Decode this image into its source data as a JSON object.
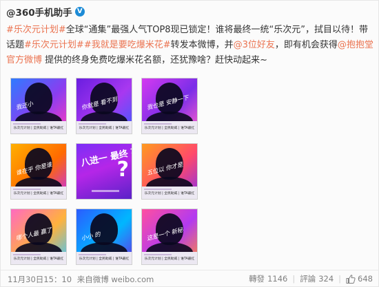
{
  "user": {
    "name": "@360手机助手",
    "verified_mark": "V"
  },
  "post": {
    "segments": [
      {
        "type": "tag",
        "text": "#乐次元计划#"
      },
      {
        "type": "text",
        "text": "全球“通集”最强人气TOP8现已锁定！谁将最终一统“乐次元”，拭目以待！带话题"
      },
      {
        "type": "tag",
        "text": "#乐次元计划#"
      },
      {
        "type": "tag",
        "text": "#我就是要吃爆米花#"
      },
      {
        "type": "text",
        "text": "转发本微博，并"
      },
      {
        "type": "mention",
        "text": "@3位好友"
      },
      {
        "type": "text",
        "text": "，即有机会获得"
      },
      {
        "type": "mention",
        "text": "@抱抱堂官方微博"
      },
      {
        "type": "text",
        "text": " 提供的终身免费吃爆米花名额，还犹豫啥？赶快动起来~"
      }
    ]
  },
  "images": [
    {
      "scribble": "我还小",
      "band": "乐次元计划 | 全民助威 | 谁TA最红",
      "colors": [
        "#2f7bff",
        "#8a3df0",
        "#ff3cbe"
      ],
      "silhouette": true
    },
    {
      "scribble": "你就是  看不到",
      "band": "乐次元计划 | 全民助威 | 谁TA最红",
      "colors": [
        "#6a1ee0",
        "#a838f0",
        "#3e5cff"
      ],
      "silhouette": true
    },
    {
      "scribble": "我也是 安静一下",
      "band": "乐次元计划 | 全民助威 | 谁TA最红",
      "colors": [
        "#d43af0",
        "#7a2ee8",
        "#ff5fcb"
      ],
      "silhouette": true
    },
    {
      "scribble": "谁在乎 你是谁",
      "band": "乐次元计划 | 全民助威 | 谁TA最红",
      "colors": [
        "#ffb000",
        "#ff6a00",
        "#c42ef0"
      ],
      "silhouette": true
    },
    {
      "big_text": "八进一 最终 花落谁家",
      "q": "?",
      "colors": [
        "#7b2ff7",
        "#b526e8",
        "#5a22c8"
      ],
      "silhouette": false
    },
    {
      "scribble": "五位以 你才是",
      "band": "乐次元计划 | 全民助威 | 谁TA最红",
      "colors": [
        "#ff9a1f",
        "#ff4a6a",
        "#8a2ee8"
      ],
      "silhouette": true
    },
    {
      "scribble": "哪个人最 赢了",
      "band": "乐次元计划 | 全民助威 | 谁TA最红",
      "colors": [
        "#ff6ac0",
        "#ffb23d",
        "#3fc6ff"
      ],
      "silhouette": true
    },
    {
      "scribble": "小小 的",
      "band": "乐次元计划 | 全民助威 | 谁TA最红",
      "colors": [
        "#2b5cff",
        "#00b7ff",
        "#6a2ee8"
      ],
      "silhouette": true
    },
    {
      "scribble": "这是一个 新秘",
      "band": "乐次元计划 | 全民助威 | 谁TA最红",
      "colors": [
        "#ff4fa0",
        "#b23af0",
        "#ff8a3d"
      ],
      "silhouette": true
    }
  ],
  "footer": {
    "time": "11月30日15：10",
    "source": "来自微博 weibo.com",
    "repost_label": "轉發",
    "repost_count": "1146",
    "comment_label": "評論",
    "comment_count": "324",
    "like_count": "648",
    "thumb_icon": "thumbs-up-icon"
  },
  "colors": {
    "link": "#eb7350",
    "verified": "#1d8bd6",
    "meta_text": "#808080"
  }
}
